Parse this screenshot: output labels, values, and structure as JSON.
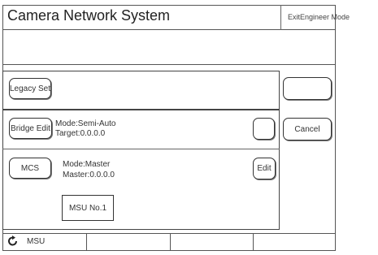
{
  "header": {
    "title": "Camera Network System",
    "exit_label": "ExitEngineer Mode"
  },
  "rows": {
    "legacy": {
      "button_label": "Legacy Set"
    },
    "bridge": {
      "button_label": "Bridge Edit",
      "mode_text": "Mode:Semi-Auto",
      "target_text": "Target:0.0.0.0"
    },
    "mcs": {
      "button_label": "MCS",
      "mode_text": "Mode:Master",
      "master_text": "Master:0.0.0.0",
      "edit_label": "Edit",
      "msu_label": "MSU No.1"
    }
  },
  "right_panel": {
    "cancel_label": "Cancel"
  },
  "tabs": [
    {
      "label": "MSU",
      "icon": "refresh-icon"
    },
    {
      "label": ""
    },
    {
      "label": ""
    },
    {
      "label": ""
    }
  ]
}
